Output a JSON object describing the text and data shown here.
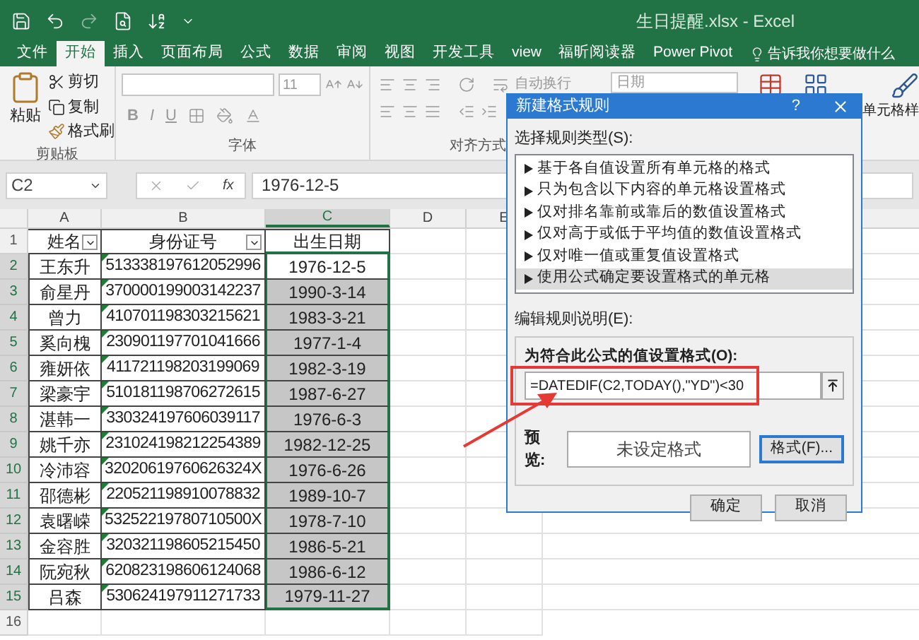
{
  "window": {
    "title": "生日提醒.xlsx  -  Excel"
  },
  "ribbon_tabs": [
    {
      "label": "文件",
      "selected": false
    },
    {
      "label": "开始",
      "selected": true
    },
    {
      "label": "插入",
      "selected": false
    },
    {
      "label": "页面布局",
      "selected": false
    },
    {
      "label": "公式",
      "selected": false
    },
    {
      "label": "数据",
      "selected": false
    },
    {
      "label": "审阅",
      "selected": false
    },
    {
      "label": "视图",
      "selected": false
    },
    {
      "label": "开发工具",
      "selected": false
    },
    {
      "label": "view",
      "selected": false
    },
    {
      "label": "福昕阅读器",
      "selected": false
    },
    {
      "label": "Power Pivot",
      "selected": false
    }
  ],
  "tell_me": "告诉我你想要做什么",
  "ribbon": {
    "clipboard": {
      "paste": "粘贴",
      "cut": "剪切",
      "copy": "复制",
      "format_painter": "格式刷",
      "label": "剪贴板"
    },
    "font": {
      "size": "11",
      "bold": "B",
      "italic": "I",
      "underline": "U",
      "label": "字体"
    },
    "alignment": {
      "wrap_text": "自动换行",
      "label": "对齐方式"
    },
    "number": {
      "format": "日期"
    },
    "styles": {
      "cell_styles": "单元格样"
    }
  },
  "formula_bar": {
    "name_box": "C2",
    "fx_label": "fx",
    "value": "1976-12-5"
  },
  "sheet": {
    "columns": [
      {
        "label": "A",
        "selected": false
      },
      {
        "label": "B",
        "selected": false
      },
      {
        "label": "C",
        "selected": true
      },
      {
        "label": "D",
        "selected": false
      },
      {
        "label": "E",
        "selected": false
      }
    ],
    "header_row": {
      "number": "1",
      "cells": [
        {
          "text": "姓名",
          "filter": true
        },
        {
          "text": "身份证号",
          "filter": true
        },
        {
          "text": "出生日期",
          "filter": false
        }
      ]
    },
    "rows": [
      {
        "number": "2",
        "selected": true,
        "active": true,
        "note_mark": true,
        "cells": [
          "王东升",
          "513338197612052996",
          "1976-12-5"
        ]
      },
      {
        "number": "3",
        "selected": true,
        "active": false,
        "note_mark": true,
        "cells": [
          "俞星丹",
          "370000199003142237",
          "1990-3-14"
        ]
      },
      {
        "number": "4",
        "selected": true,
        "active": false,
        "note_mark": true,
        "cells": [
          "曾力",
          "410701198303215621",
          "1983-3-21"
        ]
      },
      {
        "number": "5",
        "selected": true,
        "active": false,
        "note_mark": true,
        "cells": [
          "奚向槐",
          "230901197701041666",
          "1977-1-4"
        ]
      },
      {
        "number": "6",
        "selected": true,
        "active": false,
        "note_mark": true,
        "cells": [
          "雍妍依",
          "411721198203199069",
          "1982-3-19"
        ]
      },
      {
        "number": "7",
        "selected": true,
        "active": false,
        "note_mark": true,
        "cells": [
          "梁豪宇",
          "510181198706272615",
          "1987-6-27"
        ]
      },
      {
        "number": "8",
        "selected": true,
        "active": false,
        "note_mark": true,
        "cells": [
          "湛韩一",
          "330324197606039117",
          "1976-6-3"
        ]
      },
      {
        "number": "9",
        "selected": true,
        "active": false,
        "note_mark": true,
        "cells": [
          "姚千亦",
          "231024198212254389",
          "1982-12-25"
        ]
      },
      {
        "number": "10",
        "selected": true,
        "active": false,
        "note_mark": true,
        "cells": [
          "冷沛容",
          "32020619760626324X",
          "1976-6-26"
        ]
      },
      {
        "number": "11",
        "selected": true,
        "active": false,
        "note_mark": true,
        "cells": [
          "邵德彬",
          "220521198910078832",
          "1989-10-7"
        ]
      },
      {
        "number": "12",
        "selected": true,
        "active": false,
        "note_mark": true,
        "cells": [
          "袁曙嵘",
          "53252219780710500X",
          "1978-7-10"
        ]
      },
      {
        "number": "13",
        "selected": true,
        "active": false,
        "note_mark": true,
        "cells": [
          "金容胜",
          "320321198605215450",
          "1986-5-21"
        ]
      },
      {
        "number": "14",
        "selected": true,
        "active": false,
        "note_mark": true,
        "cells": [
          "阮宛秋",
          "620823198606124068",
          "1986-6-12"
        ]
      },
      {
        "number": "15",
        "selected": true,
        "active": false,
        "note_mark": true,
        "cells": [
          "吕森",
          "530624197911271733",
          "1979-11-27"
        ]
      }
    ],
    "empty_rows": [
      "16"
    ]
  },
  "dialog": {
    "title": "新建格式规则",
    "help": "?",
    "rule_type_label": "选择规则类型(S):",
    "rule_types": [
      {
        "label": "基于各自值设置所有单元格的格式",
        "selected": false
      },
      {
        "label": "只为包含以下内容的单元格设置格式",
        "selected": false
      },
      {
        "label": "仅对排名靠前或靠后的数值设置格式",
        "selected": false
      },
      {
        "label": "仅对高于或低于平均值的数值设置格式",
        "selected": false
      },
      {
        "label": "仅对唯一值或重复值设置格式",
        "selected": false
      },
      {
        "label": "使用公式确定要设置格式的单元格",
        "selected": true
      }
    ],
    "description_label": "编辑规则说明(E):",
    "formula_label": "为符合此公式的值设置格式(O):",
    "formula": "=DATEDIF(C2,TODAY(),\"YD\")<30",
    "preview_label": "预览:",
    "preview_text": "未设定格式",
    "format_button": "格式(F)...",
    "buttons": [
      "确定",
      "取消"
    ]
  }
}
